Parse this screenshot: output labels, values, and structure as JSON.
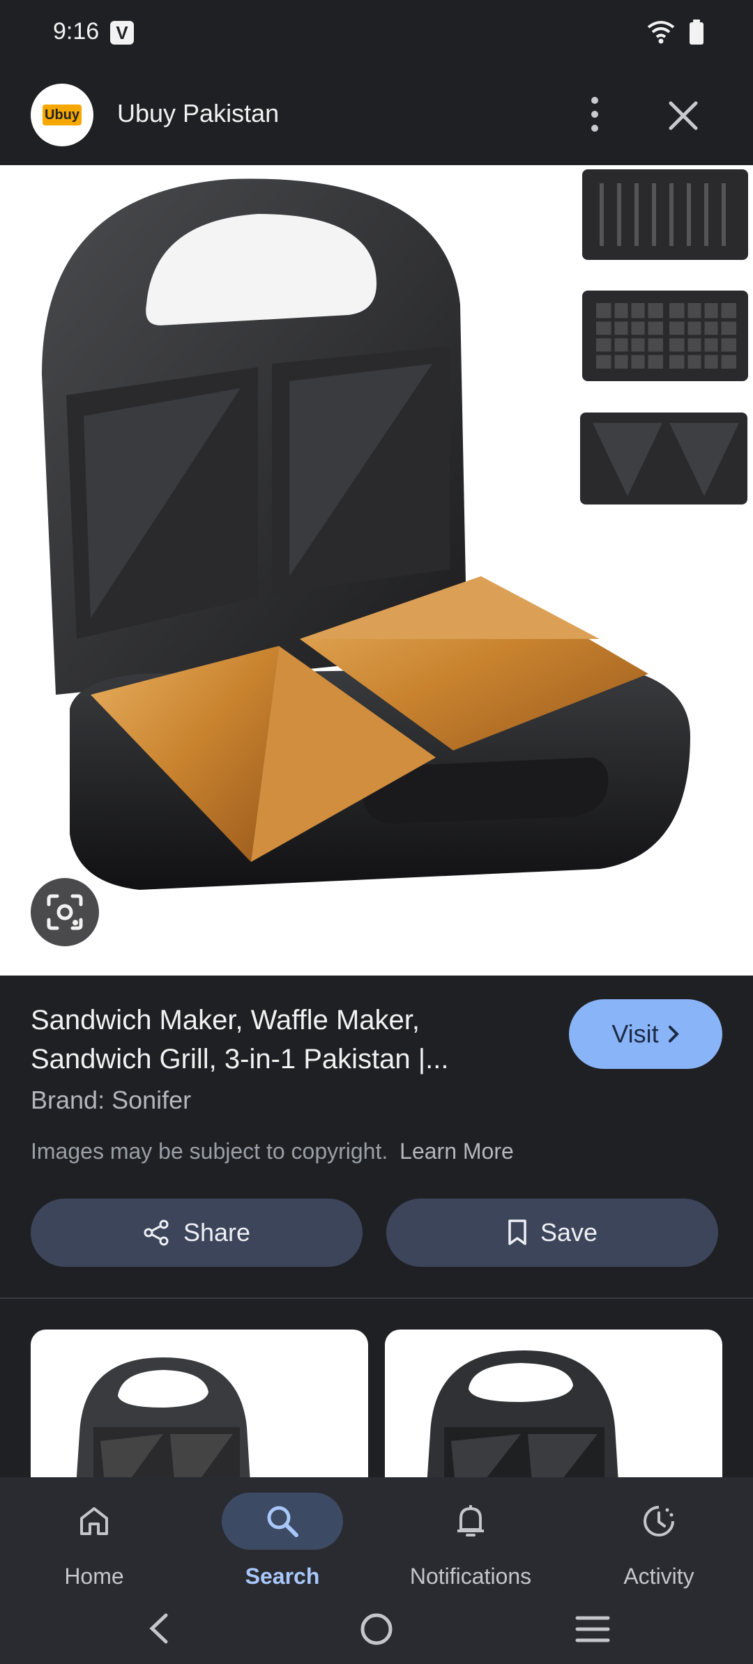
{
  "status_bar": {
    "time": "9:16",
    "badge": "V"
  },
  "header": {
    "site_name": "Ubuy Pakistan",
    "logo_text": "Ubuy"
  },
  "product": {
    "title": "Sandwich Maker, Waffle Maker, Sandwich Grill, 3-in-1 Pakistan |...",
    "brand": "Brand: Sonifer",
    "copyright": "Images may be subject to copyright.",
    "learn_more": "Learn More",
    "visit_label": "Visit"
  },
  "actions": {
    "share_label": "Share",
    "save_label": "Save"
  },
  "bottom_nav": {
    "items": [
      {
        "label": "Home",
        "icon": "home-icon"
      },
      {
        "label": "Search",
        "icon": "search-icon",
        "active": true
      },
      {
        "label": "Notifications",
        "icon": "bell-icon"
      },
      {
        "label": "Activity",
        "icon": "activity-icon"
      }
    ]
  },
  "colors": {
    "accent": "#8ab4f8",
    "background": "#1f2024",
    "button": "#3c4559"
  }
}
